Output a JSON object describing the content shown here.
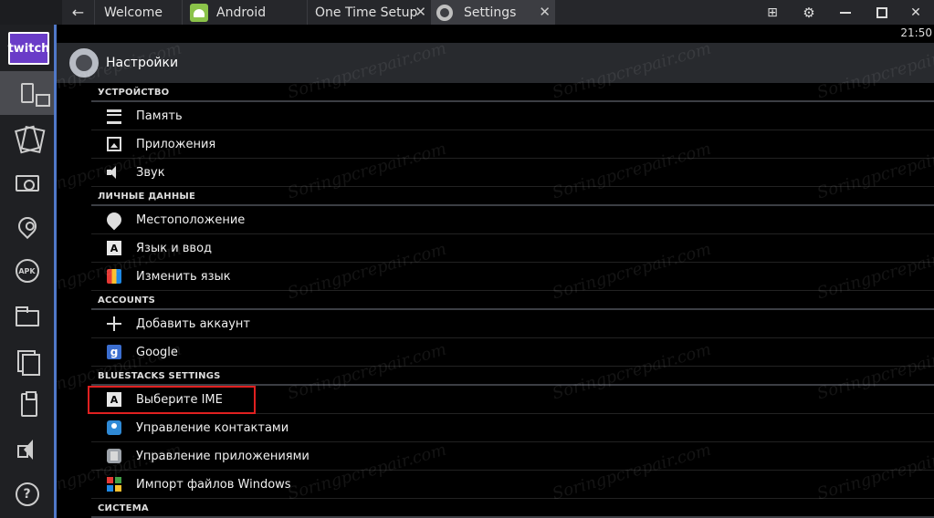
{
  "tabs": {
    "welcome": "Welcome",
    "android": "Android",
    "onetime": "One Time Setup",
    "settings": "Settings"
  },
  "window_controls": {
    "close_glyph": "✕",
    "tab_close_glyph": "✕",
    "back_glyph": "←",
    "gear_glyph": "⚙",
    "multi_glyph": "⊞"
  },
  "sidebar": {
    "logo_text": "twitch",
    "apk_label": "APK",
    "help_label": "?"
  },
  "status": {
    "time": "21:50"
  },
  "header": {
    "title": "Настройки"
  },
  "sections": [
    {
      "title": "УСТРОЙСТВО",
      "items": [
        {
          "label": "Память",
          "icon": "memory-icon"
        },
        {
          "label": "Приложения",
          "icon": "apps-icon"
        },
        {
          "label": "Звук",
          "icon": "sound-icon"
        }
      ]
    },
    {
      "title": "ЛИЧНЫЕ ДАННЫЕ",
      "items": [
        {
          "label": "Местоположение",
          "icon": "location-icon"
        },
        {
          "label": "Язык и ввод",
          "icon": "language-icon",
          "glyph": "A"
        },
        {
          "label": "Изменить язык",
          "icon": "change-language-icon"
        }
      ]
    },
    {
      "title": "ACCOUNTS",
      "items": [
        {
          "label": "Добавить аккаунт",
          "icon": "add-icon"
        },
        {
          "label": "Google",
          "icon": "google-icon",
          "glyph": "g"
        }
      ]
    },
    {
      "title": "BLUESTACKS SETTINGS",
      "items": [
        {
          "label": "Выберите IME",
          "icon": "ime-icon",
          "glyph": "A"
        },
        {
          "label": "Управление контактами",
          "icon": "contacts-icon"
        },
        {
          "label": "Управление приложениями",
          "icon": "app-manage-icon"
        },
        {
          "label": "Импорт файлов Windows",
          "icon": "windows-icon"
        }
      ]
    },
    {
      "title": "СИСТЕМА",
      "items": []
    }
  ],
  "watermark": "Soringpcrepair.com",
  "colors": {
    "sidebar_accent": "#5078c8",
    "highlight_box": "#e02020",
    "twitch_purple": "#6a3cc8"
  }
}
